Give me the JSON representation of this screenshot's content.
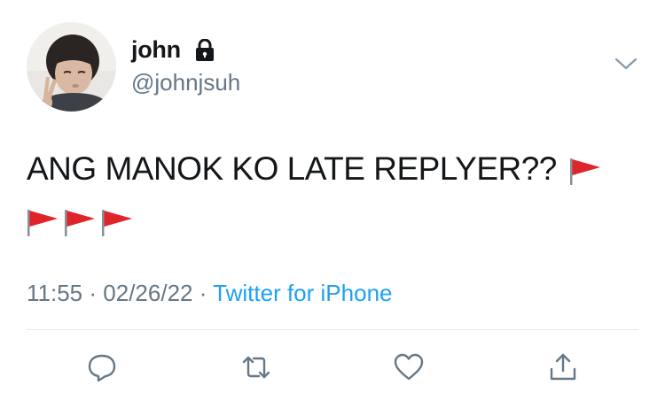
{
  "user": {
    "name": "john",
    "handle": "@johnjsuh",
    "avatar_icon": "profile-photo",
    "protected_icon": "lock-icon"
  },
  "tweet": {
    "text": "ANG MANOK KO LATE REPLYER??",
    "emoji": [
      "red-flag",
      "red-flag",
      "red-flag",
      "red-flag"
    ]
  },
  "meta": {
    "time": "11:55",
    "separator": "·",
    "date": "02/26/22",
    "source": "Twitter for iPhone"
  },
  "actions": [
    "reply-icon",
    "retweet-icon",
    "like-icon",
    "share-icon"
  ],
  "colors": {
    "text": "#14171a",
    "muted": "#657786",
    "link": "#1da1f2",
    "flag": "#e0242b"
  }
}
